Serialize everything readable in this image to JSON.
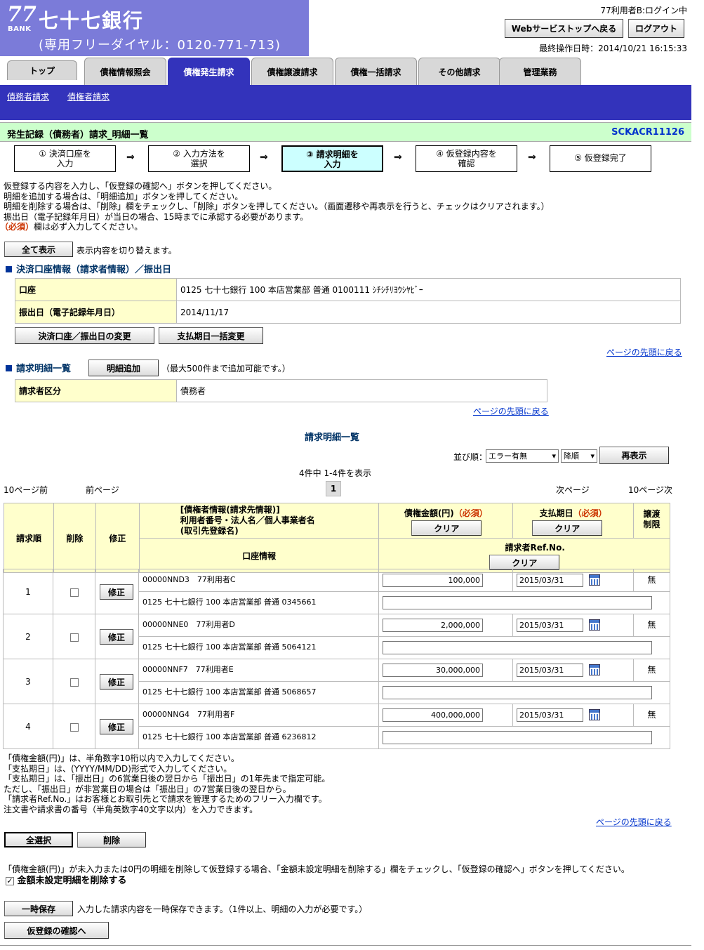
{
  "header": {
    "logo_num": "77",
    "logo_bank": "BANK",
    "bank_name": "七十七銀行",
    "free_dial": "(専用フリーダイヤル：0120-771-713)",
    "user_status": "77利用者B:ログイン中",
    "web_top_btn": "Webサービストップへ戻る",
    "logout_btn": "ログアウト",
    "last_operation": "最終操作日時：2014/10/21 16:15:33"
  },
  "tabs": [
    {
      "label": "トップ"
    },
    {
      "label": "債権情報照会"
    },
    {
      "label": "債権発生請求"
    },
    {
      "label": "債権譲渡請求"
    },
    {
      "label": "債権一括請求"
    },
    {
      "label": "その他請求"
    },
    {
      "label": "管理業務"
    }
  ],
  "subnav": [
    "債務者請求",
    "債権者請求"
  ],
  "page": {
    "title": "発生記録（債務者）請求_明細一覧",
    "screen_id": "SCKACR11126"
  },
  "steps": [
    {
      "l1": "① 決済口座を",
      "l2": "入力"
    },
    {
      "l1": "② 入力方法を",
      "l2": "選択"
    },
    {
      "l1": "③ 請求明細を",
      "l2": "入力"
    },
    {
      "l1": "④ 仮登録内容を",
      "l2": "確認"
    },
    {
      "l1": "⑤ 仮登録完了",
      "l2": ""
    }
  ],
  "step_arrow": "⇒",
  "instructions": [
    "仮登録する内容を入力し、「仮登録の確認へ」ボタンを押してください。",
    "明細を追加する場合は、「明細追加」ボタンを押してください。",
    "明細を削除する場合は、「削除」欄をチェックし、「削除」ボタンを押してください。（画面遷移や再表示を行うと、チェックはクリアされます。）",
    "振出日（電子記録年月日）が当日の場合、15時までに承認する必要があります。"
  ],
  "required_mark": "（必須）",
  "required_note": "欄は必ず入力してください。",
  "show_all": {
    "button": "全て表示",
    "note": "表示内容を切り替えます。"
  },
  "account_section": {
    "heading": "決済口座情報（請求者情報）／振出日",
    "rows": [
      {
        "label": "口座",
        "value": "0125 七十七銀行 100 本店営業部 普通 0100111 ｼﾁｼﾁﾘﾖｳｼﾔﾋﾞｰ"
      },
      {
        "label": "振出日（電子記録年月日）",
        "value": "2014/11/17"
      }
    ],
    "change_btn": "決済口座／振出日の変更",
    "bulk_change_btn": "支払期日一括変更"
  },
  "back_to_top": "ページの先頭に戻る",
  "detail_section": {
    "heading": "請求明細一覧",
    "add_btn": "明細追加",
    "add_note": "（最大500件まで追加可能です。）",
    "row_label": "請求者区分",
    "row_value": "債務者"
  },
  "list": {
    "title": "請求明細一覧",
    "sort_label": "並び順：",
    "sort_value": "エラー有無",
    "order_value": "降順",
    "redisplay_btn": "再表示",
    "count_text": "4件中 1-4件を表示",
    "pager": {
      "prev10": "10ページ前",
      "prev": "前ページ",
      "current": "1",
      "next": "次ページ",
      "next10": "10ページ次"
    },
    "headers": {
      "order": "請求順",
      "delete": "削除",
      "edit": "修正",
      "creditor_l1": "[債権者情報(請求先情報)]",
      "creditor_l2": "利用者番号・法人名／個人事業者名",
      "creditor_l3": "(取引先登録名)",
      "account": "口座情報",
      "amount": "債権金額(円)",
      "due": "支払期日",
      "transfer_l1": "譲渡",
      "transfer_l2": "制限",
      "ref": "請求者Ref.No.",
      "clear": "クリア"
    },
    "rows": [
      {
        "no": "1",
        "edit": "修正",
        "user": "00000NND3　77利用者C",
        "account": "0125 七十七銀行 100 本店営業部 普通 0345661",
        "amount": "100,000",
        "due": "2015/03/31",
        "transfer": "無"
      },
      {
        "no": "2",
        "edit": "修正",
        "user": "00000NNE0　77利用者D",
        "account": "0125 七十七銀行 100 本店営業部 普通 5064121",
        "amount": "2,000,000",
        "due": "2015/03/31",
        "transfer": "無"
      },
      {
        "no": "3",
        "edit": "修正",
        "user": "00000NNF7　77利用者E",
        "account": "0125 七十七銀行 100 本店営業部 普通 5068657",
        "amount": "30,000,000",
        "due": "2015/03/31",
        "transfer": "無"
      },
      {
        "no": "4",
        "edit": "修正",
        "user": "00000NNG4　77利用者F",
        "account": "0125 七十七銀行 100 本店営業部 普通 6236812",
        "amount": "400,000,000",
        "due": "2015/03/31",
        "transfer": "無"
      }
    ]
  },
  "notes": [
    "「債権金額(円)」は、半角数字10桁以内で入力してください。",
    "「支払期日」は、(YYYY/MM/DD)形式で入力してください。",
    "「支払期日」は、「振出日」の6営業日後の翌日から「振出日」の1年先まで指定可能。",
    "ただし、「振出日」が非営業日の場合は「振出日」の7営業日後の翌日から。",
    "「請求者Ref.No.」はお客様とお取引先とで請求を管理するためのフリー入力欄です。",
    "注文書や請求書の番号（半角英数字40文字以内）を入力できます。"
  ],
  "bottom": {
    "select_all_btn": "全選択",
    "delete_btn": "削除",
    "zero_note": "「債権金額(円)」が未入力または0円の明細を削除して仮登録する場合、「金額未設定明細を削除する」欄をチェックし、「仮登録の確認へ」ボタンを押してください。",
    "zero_checkbox_label": "金額未設定明細を削除する",
    "save_btn": "一時保存",
    "save_note": "入力した請求内容を一時保存できます。（1件以上、明細の入力が必要です。）",
    "confirm_btn": "仮登録の確認へ"
  }
}
